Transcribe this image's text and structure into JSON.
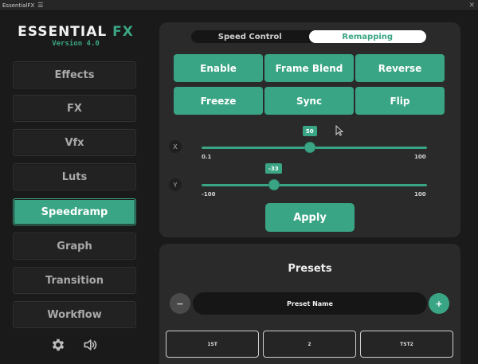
{
  "window": {
    "title": "EssentialFX",
    "menu_glyph": "☰",
    "close_glyph": "✕"
  },
  "sidebar": {
    "logo_main": "ESSENTIAL ",
    "logo_accent": "FX",
    "version": "Version 4.0",
    "items": [
      {
        "label": "Effects",
        "active": false
      },
      {
        "label": "FX",
        "active": false
      },
      {
        "label": "Vfx",
        "active": false
      },
      {
        "label": "Luts",
        "active": false
      },
      {
        "label": "Speedramp",
        "active": true
      },
      {
        "label": "Graph",
        "active": false
      },
      {
        "label": "Transition",
        "active": false
      },
      {
        "label": "Workflow",
        "active": false
      }
    ],
    "footer_icons": [
      "gear-icon",
      "speaker-icon"
    ]
  },
  "speed": {
    "tabs": [
      {
        "label": "Speed Control",
        "active": false
      },
      {
        "label": "Remapping",
        "active": true
      }
    ],
    "buttons": [
      "Enable",
      "Frame Blend",
      "Reverse",
      "Freeze",
      "Sync",
      "Flip"
    ],
    "sliders": [
      {
        "axis": "X",
        "value": 50,
        "value_label": "50",
        "min_label": "0.1",
        "max_label": "100",
        "fraction": 0.48
      },
      {
        "axis": "Y",
        "value": -33,
        "value_label": "-33",
        "min_label": "-100",
        "max_label": "100",
        "fraction": 0.32
      }
    ],
    "apply_label": "Apply"
  },
  "presets": {
    "title": "Presets",
    "minus_label": "−",
    "plus_label": "+",
    "name_placeholder": "Preset Name",
    "slots": [
      "1ST",
      "2",
      "TST2"
    ]
  },
  "colors": {
    "accent": "#3aa584",
    "panel": "#2a2a2a",
    "background": "#1a1a1a"
  }
}
